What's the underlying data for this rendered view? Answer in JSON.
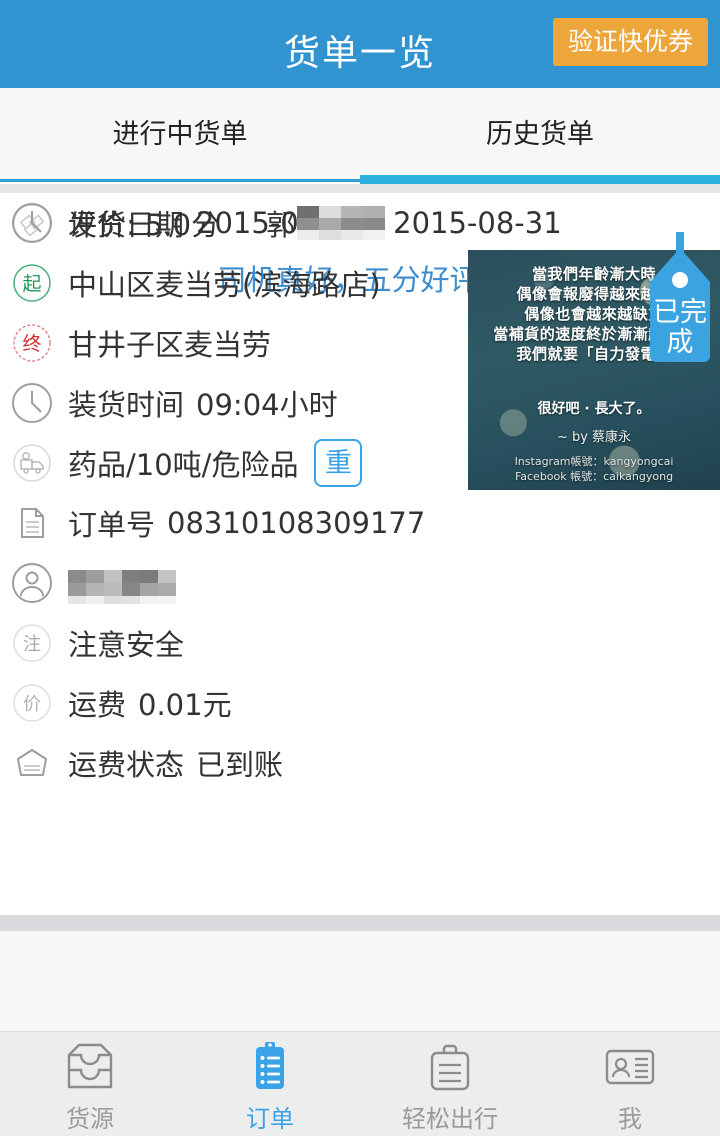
{
  "header": {
    "title": "货单一览",
    "action_label": "验证快优券",
    "bg_color": "#3194d0",
    "action_color": "#eca63c"
  },
  "tabs": [
    {
      "label": "进行中货单",
      "active": false
    },
    {
      "label": "历史货单",
      "active": true
    }
  ],
  "order": {
    "rows": [
      {
        "icon": "clock-icon",
        "label": "发货日期",
        "value": "2015-08-31"
      },
      {
        "icon": "origin-icon",
        "label": "中山区麦当劳(滨海路店)",
        "value": ""
      },
      {
        "icon": "dest-icon",
        "label": "甘井子区麦当劳",
        "value": ""
      },
      {
        "icon": "clock-icon",
        "label": "装货时间",
        "value": "09:04小时"
      },
      {
        "icon": "truck-icon",
        "label": "药品/10吨/危险品",
        "value": "",
        "tag": "重"
      },
      {
        "icon": "document-icon",
        "label": "订单号",
        "value": "08310108309177"
      },
      {
        "icon": "person-icon",
        "label": "",
        "value": "",
        "redacted": true
      },
      {
        "icon": "note-icon",
        "label": "注意安全",
        "value": ""
      },
      {
        "icon": "price-icon",
        "label": "运费",
        "value": "0.01元"
      },
      {
        "icon": "wallet-icon",
        "label": "运费状态",
        "value": "已到账"
      }
    ],
    "origin_mark": "起",
    "dest_mark": "终",
    "note_mark": "注",
    "price_mark": "价",
    "heavy_tag": "重"
  },
  "review": {
    "icon": "rating-icon",
    "score_label": "评价: 5.0分",
    "reviewer_prefix": "郭",
    "date": "2015-08-31",
    "comment": "司机真好，五分好评",
    "comment_color": "#3c8dd0"
  },
  "status_badge": {
    "label": "已完成",
    "color": "#3aa3e0"
  },
  "thumbnail": {
    "lines": [
      "當我們年齡漸大時",
      "偶像會報廢得越來越快",
      "偶像也會越來越缺貨",
      "當補貨的速度終於漸漸趕不上",
      "我們就要「自力發電」"
    ],
    "signoff": "很好吧 · 長大了。",
    "author": "~ by 蔡康永",
    "social": [
      "Instagram帳號：kangyongcai",
      "Facebook 帳號：caikangyong"
    ]
  },
  "bottom_nav": [
    {
      "label": "货源",
      "icon": "inbox-icon",
      "active": false
    },
    {
      "label": "订单",
      "icon": "clipboard-icon",
      "active": true
    },
    {
      "label": "轻松出行",
      "icon": "briefcase-icon",
      "active": false
    },
    {
      "label": "我",
      "icon": "idcard-icon",
      "active": false
    }
  ]
}
